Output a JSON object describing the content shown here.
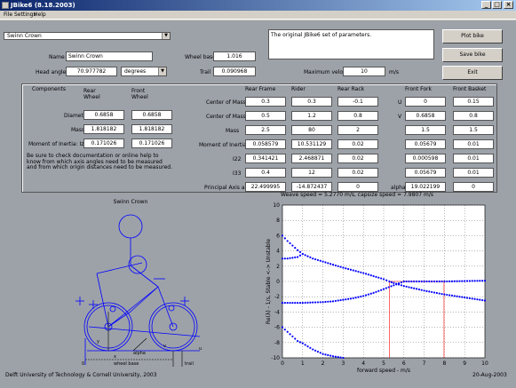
{
  "window": {
    "title": "JBike6 (8.18.2003)"
  },
  "menu": [
    "File",
    "Settings",
    "Help"
  ],
  "preset": "Swinn Crown",
  "name": "Swinn Crown",
  "head_angle": "70.977782",
  "angle_unit": "degrees",
  "wheel_base": "1.016",
  "trail": "0.090968",
  "max_velocity": "10",
  "max_velocity_unit": "m/s",
  "description": "The original JBike6 set of parameters.",
  "labels": {
    "name": "Name",
    "head_angle": "Head angle",
    "wheel_base": "Wheel base",
    "trail": "Trail",
    "max_velocity": "Maximum velocity",
    "components": "Components",
    "rear_wheel": "Rear\nWheel",
    "front_wheel": "Front\nWheel",
    "diameter": "Diameter",
    "mass": "Mass",
    "moi_izz": "Moment of Inertia: Izz",
    "note": "Be sure to check documentation or online help to know from which axis angles need to be measured and from which origin distances need to be measured.",
    "rear_frame": "Rear Frame",
    "rider": "Rider",
    "rear_rack": "Rear Rack",
    "front_fork": "Front Fork",
    "front_basket": "Front Basket",
    "com_x": "Center of Mass X",
    "com_y": "Center of Mass Y",
    "mass2": "Mass",
    "moi_i11": "Moment of Inertia: I11",
    "i22": "I22",
    "i33": "I33",
    "principal": "Principal Axis angle",
    "u": "U",
    "v": "V",
    "alpha": "alpha"
  },
  "buttons": {
    "plot": "Plot bike",
    "save": "Save bike",
    "exit": "Exit"
  },
  "wheels": {
    "rear": {
      "diameter": "0.6858",
      "mass": "1.818182",
      "izz": "0.171026"
    },
    "front": {
      "diameter": "0.6858",
      "mass": "1.818182",
      "izz": "0.171026"
    }
  },
  "table": {
    "rear_frame": [
      "0.3",
      "0.5",
      "2.5",
      "0.058579",
      "0.341421",
      "0.4",
      "22.499995"
    ],
    "rider": [
      "0.3",
      "1.2",
      "80",
      "10.531129",
      "2.468871",
      "12",
      "-14.872437"
    ],
    "rear_rack": [
      "-0.1",
      "0.8",
      "2",
      "0.02",
      "0.02",
      "0.02",
      "0"
    ],
    "front_fork": [
      "0",
      "0.6858",
      "1.5",
      "0.05679",
      "0.000598",
      "0.05679",
      "19.022199"
    ],
    "front_basket": [
      "0.15",
      "0.8",
      "1.5",
      "0.01",
      "0.01",
      "0.01",
      "0"
    ]
  },
  "diagram": {
    "title": "Swinn Crown",
    "labels": {
      "alpha": "alpha",
      "wheel_base": "wheel base",
      "trail": "trail",
      "x": "x",
      "y": "y",
      "u": "u",
      "v": "v",
      "origin": "0"
    }
  },
  "chart_title": "Weave speed = 5.2770 m/s, capsize speed = 7.9807 m/s",
  "chart_data": {
    "type": "scatter",
    "title": "Weave speed = 5.2770 m/s, capsize speed = 7.9807 m/s",
    "xlabel": "forward speed - m/s",
    "ylabel": "Re(λ) - 1/s, Stable <-> Unstable",
    "xlim": [
      0,
      10
    ],
    "ylim": [
      -10,
      10
    ],
    "xticks": [
      "0",
      "1",
      "2",
      "3",
      "4",
      "5",
      "6",
      "7",
      "8",
      "9",
      "10"
    ],
    "yticks": [
      "10",
      "8",
      "6",
      "4",
      "2",
      "0",
      "-2",
      "-4",
      "-6",
      "-8",
      "-10"
    ],
    "grid": true,
    "weave_speed": 5.277,
    "capsize_speed": 7.9807,
    "series": [
      {
        "x": [
          0,
          0.25,
          0.5,
          0.75,
          1.0
        ],
        "y": [
          6.0,
          5.3,
          4.7,
          4.1,
          3.6
        ]
      },
      {
        "x": [
          0,
          0.25,
          0.5,
          0.75,
          1.0,
          1.25,
          1.5,
          2,
          2.5,
          3,
          3.5,
          4,
          4.5,
          5,
          5.28,
          5.5,
          6,
          7,
          8,
          9,
          10
        ],
        "y": [
          3.0,
          3.0,
          3.1,
          3.2,
          3.6,
          3.3,
          3.0,
          2.6,
          2.2,
          1.8,
          1.45,
          1.1,
          0.7,
          0.3,
          0,
          -0.2,
          -0.6,
          -1.2,
          -1.7,
          -2.1,
          -2.5
        ]
      },
      {
        "x": [
          0,
          0.5,
          1,
          1.5,
          2,
          2.5,
          3,
          3.5,
          4,
          4.5,
          5,
          5.5,
          6,
          7,
          8,
          9,
          10
        ],
        "y": [
          -2.8,
          -2.8,
          -2.8,
          -2.75,
          -2.7,
          -2.6,
          -2.4,
          -2.2,
          -1.9,
          -1.5,
          -1.0,
          -0.5,
          0,
          0,
          0,
          0.05,
          0.1
        ]
      },
      {
        "x": [
          0,
          0.25,
          0.5,
          0.75,
          1,
          1.25,
          1.5,
          1.75,
          2,
          2.5,
          3
        ],
        "y": [
          -6.0,
          -6.6,
          -7.2,
          -7.8,
          -8.1,
          -8.5,
          -8.9,
          -9.2,
          -9.5,
          -9.8,
          -10
        ]
      }
    ]
  },
  "footer": {
    "left": "Delft University of Technology & Cornell University, 2003",
    "right": "20-Aug-2003"
  }
}
